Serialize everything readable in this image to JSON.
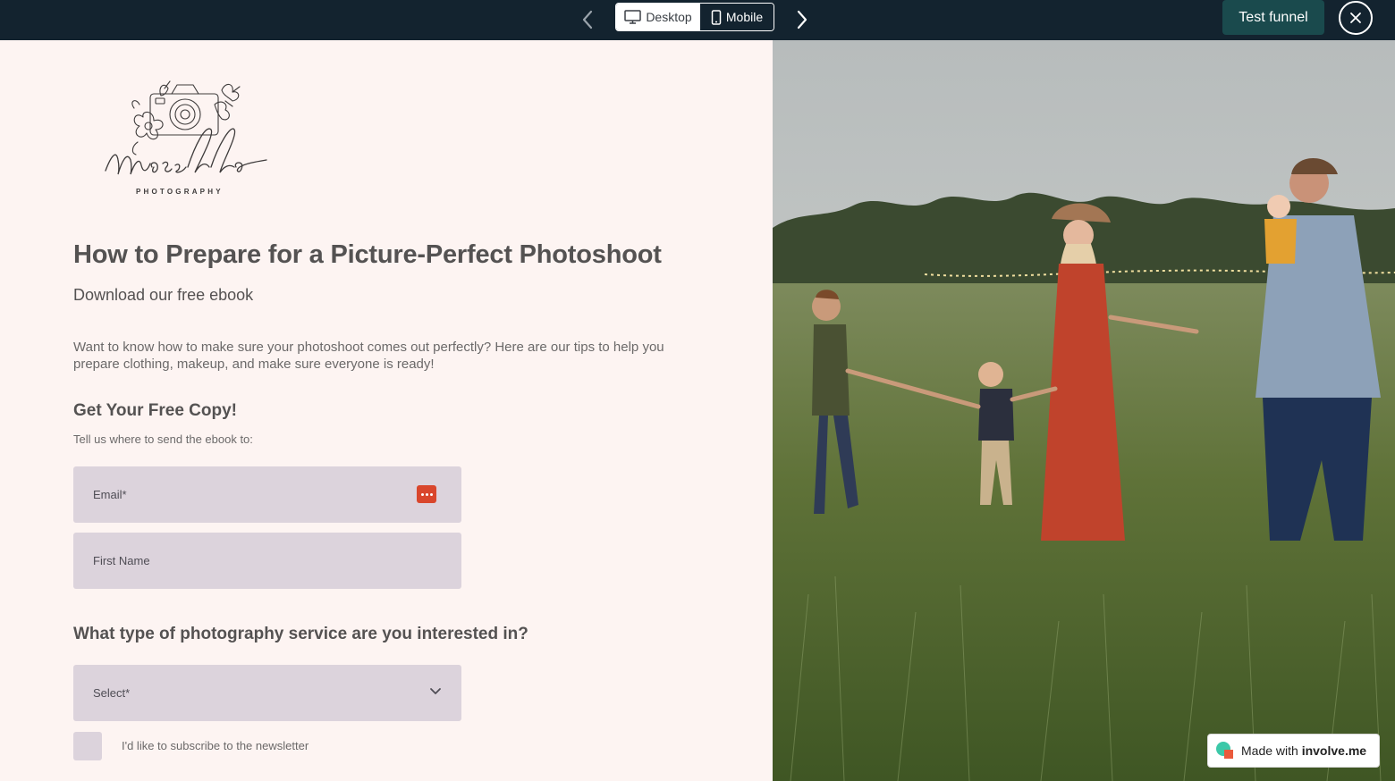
{
  "topbar": {
    "desktop_label": "Desktop",
    "mobile_label": "Mobile",
    "test_label": "Test funnel"
  },
  "logo": {
    "name": "Masella",
    "tagline": "PHOTOGRAPHY"
  },
  "content": {
    "title": "How to Prepare for a Picture-Perfect Photoshoot",
    "subtitle": "Download our free ebook",
    "intro": "Want to know how to make sure your photoshoot comes out perfectly? Here are our tips to help you prepare clothing, makeup, and make sure everyone is ready!",
    "copy_heading": "Get Your Free Copy!",
    "helper": "Tell us where to send the ebook to:"
  },
  "form": {
    "email_placeholder": "Email*",
    "firstname_placeholder": "First Name",
    "service_question": "What type of photography service are you interested in?",
    "select_placeholder": "Select*",
    "newsletter_label": "I'd like to subscribe to the newsletter"
  },
  "badge": {
    "prefix": "Made with",
    "brand": "involve.me"
  },
  "icons": [
    "chevron-left-icon",
    "desktop-icon",
    "mobile-icon",
    "chevron-right-icon",
    "close-icon",
    "password-manager-icon",
    "chevron-down-icon",
    "involve-me-logo-icon"
  ],
  "colors": {
    "topbar": "#13232f",
    "page_bg": "#fdf4f2",
    "field_bg": "#dcd3dc",
    "test_button": "#1a4a4d",
    "text": "#545252"
  }
}
